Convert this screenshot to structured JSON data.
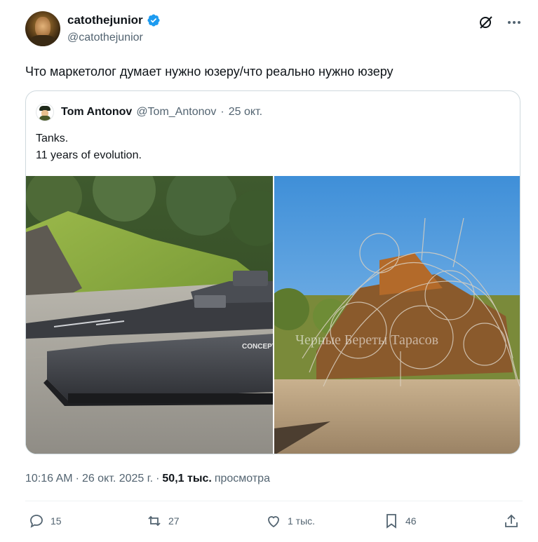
{
  "author": {
    "display_name": "catothejunior",
    "handle": "@catothejunior"
  },
  "tweet": {
    "text": "Что маркетолог думает нужно юзеру/что реально нужно юзеру"
  },
  "quote": {
    "display_name": "Tom Antonov",
    "handle": "@Tom_Antonov",
    "separator": "·",
    "date": "25 окт.",
    "text_line1": "Tanks.",
    "text_line2": "11 years of evolution.",
    "left_image_label": "CONCEPT",
    "right_image_watermark": "Черные Береты Тарасов"
  },
  "meta": {
    "time": "10:16 AM",
    "sep1": "·",
    "date": "26 окт. 2025 г.",
    "sep2": "·",
    "views_count": "50,1 тыс.",
    "views_label": "просмотра"
  },
  "actions": {
    "replies": "15",
    "reposts": "27",
    "likes": "1 тыс.",
    "bookmarks": "46"
  },
  "colors": {
    "accent": "#1d9bf0",
    "secondary_text": "#536471",
    "border": "#cfd9de"
  },
  "icons": [
    "verified-badge-icon",
    "grok-icon",
    "more-icon",
    "reply-icon",
    "repost-icon",
    "like-icon",
    "bookmark-icon",
    "share-icon"
  ]
}
